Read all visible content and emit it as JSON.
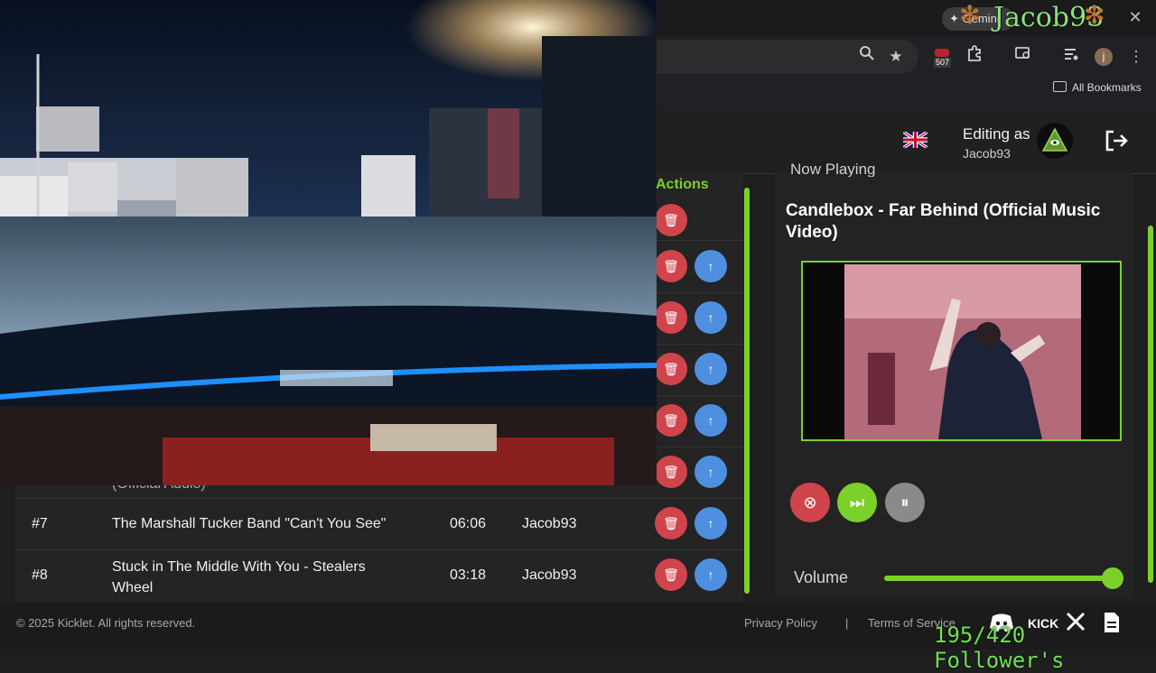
{
  "browser": {
    "gemini_label": "Gemini",
    "extension_badge": "507",
    "profile_initial": "j",
    "bookmarks_label": "All Bookmarks",
    "close_glyph": "✕"
  },
  "overlay": {
    "streamer_name": "Jacob93",
    "followers": "195/420 Follower's"
  },
  "header": {
    "editing_as": "Editing as",
    "username": "Jacob93"
  },
  "queue": {
    "actions_header": "Actions",
    "partial_row_text": "(Official Audio)",
    "rows": [
      {
        "num": "#7",
        "title": "The Marshall Tucker Band \"Can't You See\"",
        "duration": "06:06",
        "requester": "Jacob93"
      },
      {
        "num": "#8",
        "title": "Stuck in The Middle With You - Stealers Wheel",
        "duration": "03:18",
        "requester": "Jacob93"
      }
    ]
  },
  "now_playing": {
    "header_fragment": "Now Playing",
    "title": "Candlebox - Far Behind (Official Music Video)",
    "volume_label": "Volume",
    "volume": 1.0
  },
  "footer": {
    "copyright": "© 2025 Kicklet. All rights reserved.",
    "privacy": "Privacy Policy",
    "separator": "|",
    "terms": "Terms of Service"
  },
  "colors": {
    "accent": "#7bd02a",
    "delete": "#d0444c",
    "move_up": "#4f8fe0",
    "skip": "#7bd02a",
    "pause": "#8a8a8a"
  }
}
